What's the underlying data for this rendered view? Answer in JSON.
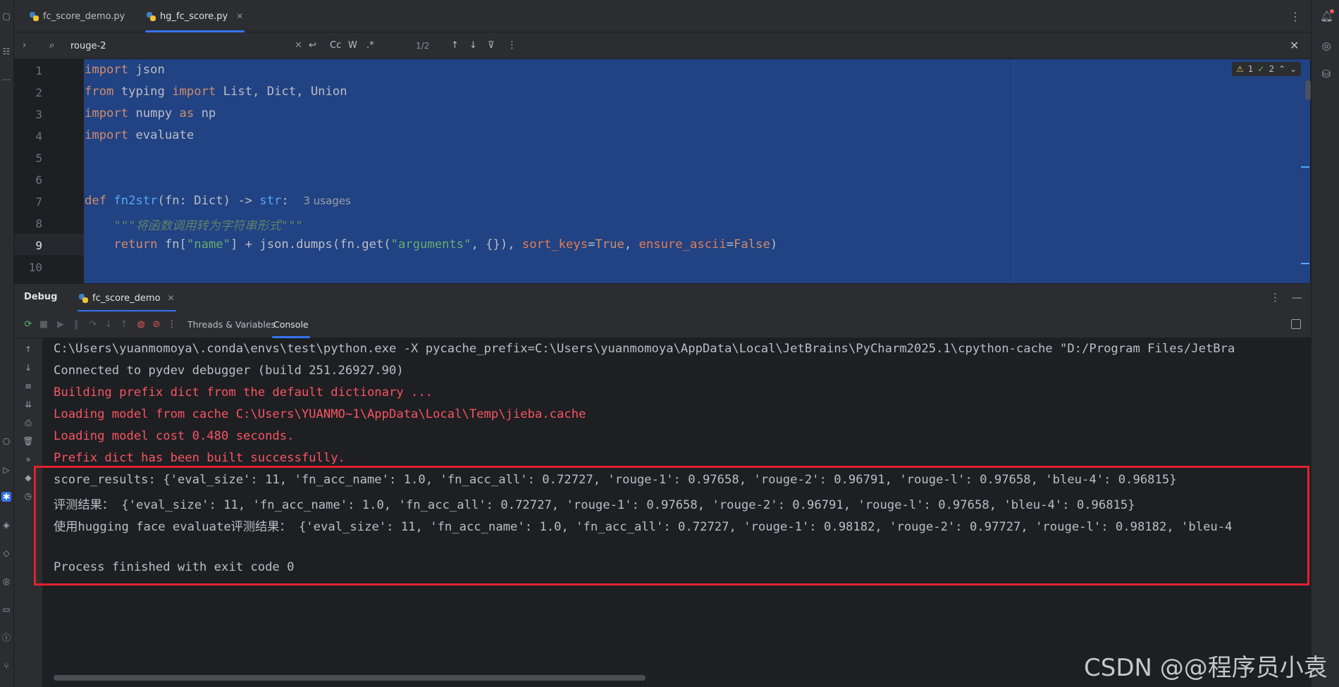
{
  "tabs": [
    {
      "label": "fc_score_demo.py"
    },
    {
      "label": "hg_fc_score.py"
    }
  ],
  "search": {
    "value": "rouge-2",
    "match_case_label": "Cc",
    "words_label": "W",
    "regex_label": ".*",
    "count": "1/2"
  },
  "editor": {
    "line_numbers": [
      "1",
      "2",
      "3",
      "4",
      "5",
      "6",
      "7",
      "8",
      "9",
      "10"
    ],
    "current_line": "9",
    "usages_hint": "3 usages",
    "docstring": "\"\"\"将函数调用转为字符串形式\"\"\"",
    "warnings": "1",
    "checks": "2",
    "line1": {
      "kw": "import",
      "rest": " json"
    },
    "line2": {
      "kw1": "from",
      "mod": " typing ",
      "kw2": "import",
      "rest": " List, Dict, Union"
    },
    "line3": {
      "kw1": "import",
      "mod": " numpy ",
      "kw2": "as",
      "rest": " np"
    },
    "line4": {
      "kw": "import",
      "rest": " evaluate"
    },
    "line7": {
      "kw": "def",
      "name": "fn2str",
      "sig": "(fn: Dict) -> ",
      "ret": "str",
      "colon": ":"
    },
    "line9": {
      "kw": "return",
      "a": " fn[",
      "s1": "\"name\"",
      "b": "] + json.dumps(fn.get(",
      "s2": "\"arguments\"",
      "c": ", {}), ",
      "p1": "sort_keys",
      "d": "=",
      "k1": "True",
      "e": ", ",
      "p2": "ensure_ascii",
      "f": "=",
      "k2": "False",
      "g": ")"
    }
  },
  "debug": {
    "title": "Debug",
    "session_tab": "fc_score_demo",
    "sub_tabs": [
      "Threads & Variables",
      "Console"
    ]
  },
  "console": {
    "lines": [
      {
        "text": "C:\\Users\\yuanmomoya\\.conda\\envs\\test\\python.exe -X pycache_prefix=C:\\Users\\yuanmomoya\\AppData\\Local\\JetBrains\\PyCharm2025.1\\cpython-cache \"D:/Program Files/JetBra",
        "type": "normal"
      },
      {
        "text": "Connected to pydev debugger (build 251.26927.90)",
        "type": "normal"
      },
      {
        "text": "Building prefix dict from the default dictionary ...",
        "type": "error"
      },
      {
        "text": "Loading model from cache C:\\Users\\YUANMO~1\\AppData\\Local\\Temp\\jieba.cache",
        "type": "error"
      },
      {
        "text": "Loading model cost 0.480 seconds.",
        "type": "error"
      },
      {
        "text": "Prefix dict has been built successfully.",
        "type": "error"
      },
      {
        "text": "score_results: {'eval_size': 11, 'fn_acc_name': 1.0, 'fn_acc_all': 0.72727, 'rouge-1': 0.97658, 'rouge-2': 0.96791, 'rouge-l': 0.97658, 'bleu-4': 0.96815}",
        "type": "normal"
      },
      {
        "text": "评测结果： {'eval_size': 11, 'fn_acc_name': 1.0, 'fn_acc_all': 0.72727, 'rouge-1': 0.97658, 'rouge-2': 0.96791, 'rouge-l': 0.97658, 'bleu-4': 0.96815}",
        "type": "normal"
      },
      {
        "text": "使用hugging face evaluate评测结果： {'eval_size': 11, 'fn_acc_name': 1.0, 'fn_acc_all': 0.72727, 'rouge-1': 0.98182, 'rouge-2': 0.97727, 'rouge-l': 0.98182, 'bleu-4",
        "type": "normal"
      },
      {
        "text": "",
        "type": "normal"
      },
      {
        "text": "Process finished with exit code 0",
        "type": "normal"
      }
    ]
  },
  "watermark": "CSDN @@程序员小袁",
  "colors": {
    "accent": "#3574f0",
    "selection": "#214283",
    "error_text": "#f75464",
    "highlight_box": "#e3212e"
  }
}
